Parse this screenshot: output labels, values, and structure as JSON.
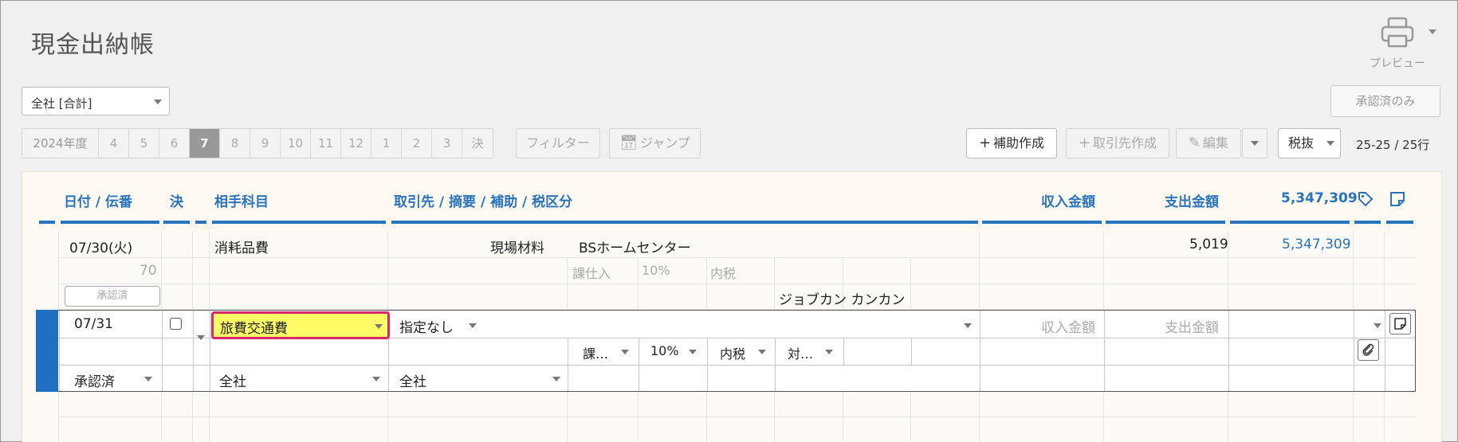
{
  "page": {
    "title": "現金出納帳"
  },
  "toolbar_top": {
    "preview_label": "プレビュー",
    "approved_only_label": "承認済のみ"
  },
  "company_select": {
    "value": "全社 [合計]"
  },
  "months": {
    "fiscal_year": "2024年度",
    "items": [
      "4",
      "5",
      "6",
      "7",
      "8",
      "9",
      "10",
      "11",
      "12",
      "1",
      "2",
      "3",
      "決"
    ],
    "active": "7"
  },
  "actions": {
    "filter_label": "フィルター",
    "jump_label": "ジャンプ",
    "aux_create_label": "補助作成",
    "partner_create_label": "取引先作成",
    "edit_label": "編集",
    "tax_mode": "税抜",
    "count": "25-25 / 25行"
  },
  "table_headers": {
    "date": "日付 / 伝番",
    "settle": "決",
    "account": "相手科目",
    "details": "取引先 / 摘要 / 補助 / 税区分",
    "income": "収入金額",
    "expense": "支出金額",
    "balance": "5,347,309"
  },
  "entry": {
    "date": "07/30(火)",
    "voucher": "70",
    "approval": "承認済",
    "account": "消耗品費",
    "memo": "現場材料",
    "partner": "BSホームセンター",
    "tax_kind": "課仕入",
    "tax_rate": "10%",
    "tax_incl": "内税",
    "sub_account": "ジョブカン カンカン",
    "expense": "5,019",
    "balance": "5,347,309"
  },
  "editor": {
    "date": "07/31",
    "account": "旅費交通費",
    "partner": "指定なし",
    "income_placeholder": "収入金額",
    "expense_placeholder": "支出金額",
    "tax_kind": "課…",
    "tax_rate": "10%",
    "tax_incl": "内税",
    "target": "対…",
    "approval": "承認済",
    "dept1": "全社",
    "dept2": "全社"
  },
  "colors": {
    "accent_blue": "#2a74bd",
    "edit_stripe": "#1f6fc5",
    "highlight_yellow": "#fdfc66",
    "highlight_border": "#d9276c"
  },
  "icons": [
    "printer-icon",
    "chevron-down-icon",
    "calendar-icon",
    "plus-icon",
    "pencil-icon",
    "tag-icon",
    "note-icon",
    "paperclip-icon"
  ]
}
